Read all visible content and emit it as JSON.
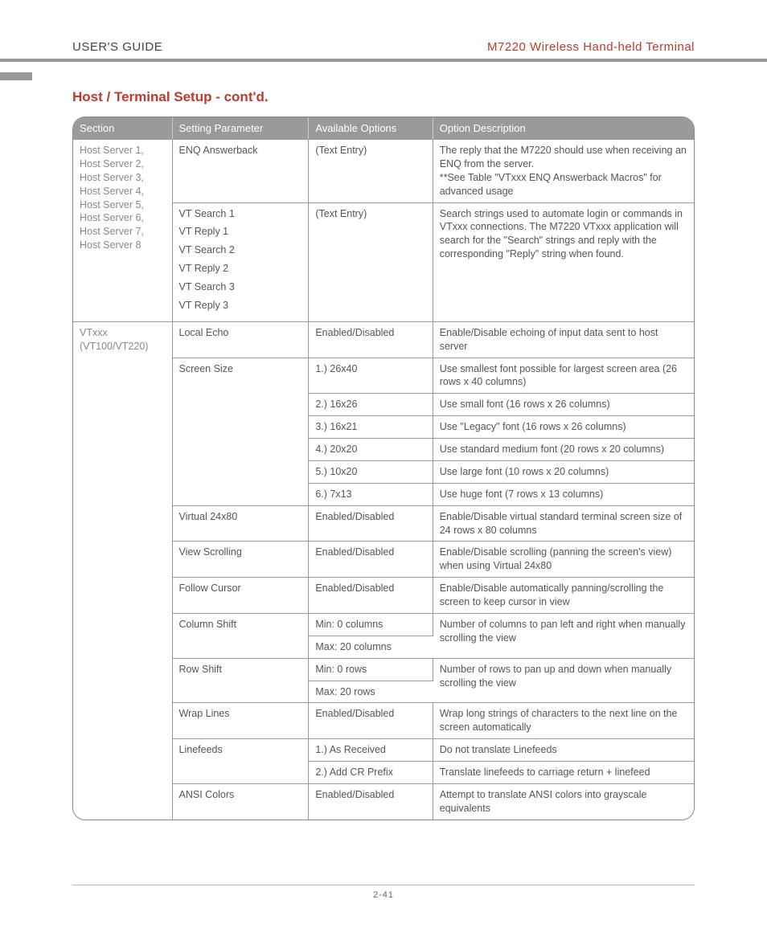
{
  "header": {
    "left": "USER'S GUIDE",
    "right": "M7220 Wireless Hand-held Terminal"
  },
  "title": "Host / Terminal Setup - cont'd.",
  "columns": {
    "c1": "Section",
    "c2": "Setting Parameter",
    "c3": "Available Options",
    "c4": "Option Description"
  },
  "sectionA": "Host Server 1, Host Server 2, Host Server 3, Host Server 4, Host Server 5, Host Server 6, Host Server 7, Host Server 8",
  "rowA1": {
    "param": "ENQ Answerback",
    "opt": "(Text Entry)",
    "desc": "The reply that the M7220 should use when receiving an ENQ from the server.\n**See Table \"VTxxx ENQ Answerback Macros\" for advanced usage"
  },
  "rowA2": {
    "params": [
      "VT Search 1",
      "VT Reply 1",
      "VT Search 2",
      "VT Reply 2",
      "VT Search 3",
      "VT Reply 3"
    ],
    "opt": "(Text Entry)",
    "desc": "Search strings used to automate login or commands in VTxxx connections.  The M7220 VTxxx application will search for the \"Search\" strings and reply with the corresponding \"Reply\" string when found."
  },
  "sectionB": "VTxxx (VT100/VT220)",
  "rowB1": {
    "param": "Local Echo",
    "opt": "Enabled/Disabled",
    "desc": "Enable/Disable echoing of input data sent to host server"
  },
  "rowB2": {
    "param": "Screen Size",
    "sub": [
      {
        "opt": "1.) 26x40",
        "desc": "Use smallest font possible for largest screen area (26 rows x 40 columns)"
      },
      {
        "opt": "2.) 16x26",
        "desc": "Use small font (16 rows x 26 columns)"
      },
      {
        "opt": "3.) 16x21",
        "desc": "Use \"Legacy\" font (16 rows x 26 columns)"
      },
      {
        "opt": "4.) 20x20",
        "desc": "Use standard medium font (20 rows x 20 columns)"
      },
      {
        "opt": "5.) 10x20",
        "desc": "Use large font (10 rows x 20 columns)"
      },
      {
        "opt": "6.) 7x13",
        "desc": "Use huge font (7 rows x 13 columns)"
      }
    ]
  },
  "rowB3": {
    "param": "Virtual 24x80",
    "opt": "Enabled/Disabled",
    "desc": "Enable/Disable virtual standard terminal screen size of 24 rows x 80 columns"
  },
  "rowB4": {
    "param": "View Scrolling",
    "opt": "Enabled/Disabled",
    "desc": "Enable/Disable scrolling (panning the screen's view) when using Virtual 24x80"
  },
  "rowB5": {
    "param": "Follow Cursor",
    "opt": "Enabled/Disabled",
    "desc": "Enable/Disable automatically panning/scrolling the screen to keep cursor in view"
  },
  "rowB6": {
    "param": "Column Shift",
    "sub": [
      {
        "opt": "Min: 0 columns"
      },
      {
        "opt": "Max: 20 columns"
      }
    ],
    "desc": "Number of columns to pan left and right when manually scrolling the view"
  },
  "rowB7": {
    "param": "Row Shift",
    "sub": [
      {
        "opt": "Min: 0 rows"
      },
      {
        "opt": "Max: 20 rows"
      }
    ],
    "desc": "Number of rows to pan up and down when manually scrolling the view"
  },
  "rowB8": {
    "param": "Wrap Lines",
    "opt": "Enabled/Disabled",
    "desc": "Wrap long strings of characters to the next line on the screen automatically"
  },
  "rowB9": {
    "param": "Linefeeds",
    "sub": [
      {
        "opt": "1.) As Received",
        "desc": "Do not translate Linefeeds"
      },
      {
        "opt": "2.) Add CR Prefix",
        "desc": "Translate linefeeds to carriage return + linefeed"
      }
    ]
  },
  "rowB10": {
    "param": "ANSI Colors",
    "opt": "Enabled/Disabled",
    "desc": "Attempt to translate ANSI colors into grayscale equivalents"
  },
  "pageNum": "2-41"
}
